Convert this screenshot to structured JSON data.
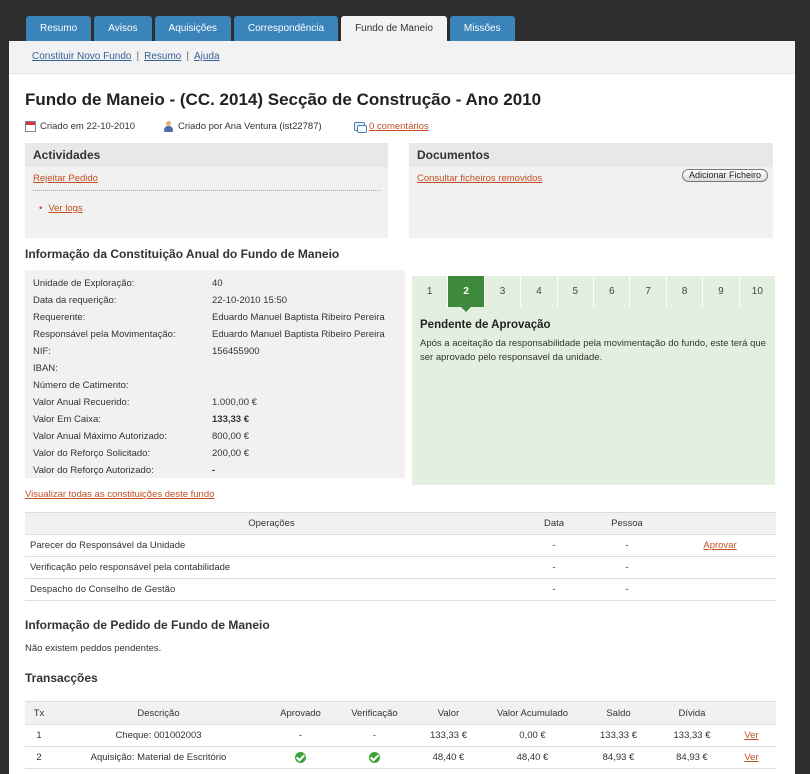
{
  "nav": {
    "tabs": [
      {
        "label": "Resumo",
        "active": false
      },
      {
        "label": "Avisos",
        "active": false
      },
      {
        "label": "Aquisições",
        "active": false
      },
      {
        "label": "Correspondência",
        "active": false
      },
      {
        "label": "Fundo de Maneio",
        "active": true
      },
      {
        "label": "Missões",
        "active": false
      }
    ]
  },
  "subnav": {
    "items": [
      "Constituir Novo Fundo",
      "Resumo",
      "Ajuda"
    ]
  },
  "page": {
    "title": "Fundo de Maneio - (CC. 2014) Secção de Construção - Ano 2010",
    "created_on": "Criado em 22-10-2010",
    "created_by": "Criado por Ana Ventura (ist22787)",
    "comments": "0 comentários"
  },
  "activities": {
    "title": "Actividades",
    "reject": "Rejeitar Pedido",
    "logs": "Ver logs"
  },
  "documents": {
    "title": "Documentos",
    "removed": "Consultar ficheiros removidos",
    "add_file": "Adicionar Ficheiro"
  },
  "annual_info": {
    "title": "Informação da Constituição Anual do Fundo de Maneio",
    "rows": [
      {
        "label": "Unidade de Exploração:",
        "value": "40"
      },
      {
        "label": "Data da requerição:",
        "value": "22-10-2010 15:50"
      },
      {
        "label": "Requerente:",
        "value": "Eduardo Manuel Baptista Ribeiro Pereira"
      },
      {
        "label": "Responsável pela Movimentação:",
        "value": "Eduardo Manuel Baptista Ribeiro Pereira"
      },
      {
        "label": "NIF:",
        "value": "156455900"
      },
      {
        "label": "IBAN:",
        "value": ""
      },
      {
        "label": "Número de Catimento:",
        "value": ""
      },
      {
        "label": "Valor Anual Recuerido:",
        "value": "1.000,00 €"
      },
      {
        "label": "Valor Em Caixa:",
        "value": "133,33 €"
      },
      {
        "label": "Valor Anual Máximo Autorizado:",
        "value": "800,00 €"
      },
      {
        "label": "Valor do Reforço Solicitado:",
        "value": "200,00 €"
      },
      {
        "label": "Valor do Reforço Autorizado:",
        "value": "-"
      }
    ],
    "view_all": "Visualizar todas as constituições deste fundo"
  },
  "progress": {
    "steps": [
      "1",
      "2",
      "3",
      "4",
      "5",
      "6",
      "7",
      "8",
      "9",
      "10"
    ],
    "active_step": 2,
    "status_title": "Pendente de Aprovação",
    "status_desc": "Após a aceitação da responsabilidade pela movimentação do fundo, este terá que ser aprovado pelo responsavel da unidade."
  },
  "operations": {
    "headers": [
      "Operações",
      "Data",
      "Pessoa",
      ""
    ],
    "rows": [
      {
        "op": "Parecer do Responsável da Unidade",
        "date": "-",
        "person": "-",
        "action": "Aprovar"
      },
      {
        "op": "Verificação pelo responsável pela contabilidade",
        "date": "-",
        "person": "-",
        "action": ""
      },
      {
        "op": "Despacho do Conselho de Gestão",
        "date": "-",
        "person": "-",
        "action": ""
      }
    ]
  },
  "request_info": {
    "title": "Informação de Pedido de Fundo de Maneio",
    "empty": "Não existem peddos pendentes."
  },
  "transactions": {
    "title": "Transacções",
    "headers": [
      "Tx",
      "Descrição",
      "Aprovado",
      "Verificação",
      "Valor",
      "Valor Acumulado",
      "Saldo",
      "Dívida",
      ""
    ],
    "rows": [
      {
        "tx": "1",
        "desc": "Cheque: 001002003",
        "approved": "-",
        "verified": "-",
        "value": "133,33 €",
        "accum": "0,00 €",
        "balance": "133,33 €",
        "debt": "133,33 €",
        "action": "Ver"
      },
      {
        "tx": "2",
        "desc": "Aquisição: Material de Escritório",
        "approved": "check",
        "verified": "check",
        "value": "48,40 €",
        "accum": "48,40 €",
        "balance": "84,93 €",
        "debt": "84,93 €",
        "action": "Ver"
      }
    ]
  }
}
